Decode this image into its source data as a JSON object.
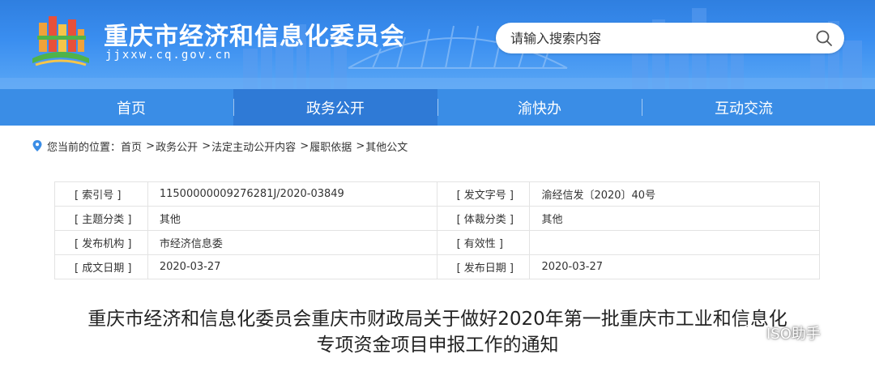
{
  "header": {
    "site_title": "重庆市经济和信息化委员会",
    "site_domain": "jjxxw.cq.gov.cn",
    "search_placeholder": "请输入搜索内容",
    "logo_icon": "city-logo-icon",
    "search_icon": "search-icon"
  },
  "nav": {
    "items": [
      {
        "label": "首页"
      },
      {
        "label": "政务公开"
      },
      {
        "label": "渝快办"
      },
      {
        "label": "互动交流"
      }
    ],
    "active": "政务公开"
  },
  "breadcrumb": {
    "prefix": "您当前的位置：",
    "items": [
      "首页",
      "政务公开",
      "法定主动公开内容",
      "履职依据",
      "其他公文"
    ],
    "separator": ">"
  },
  "info": {
    "rows": [
      {
        "l1": "[ 索引号 ]",
        "v1": "11500000009276281J/2020-03849",
        "l2": "[ 发文字号 ]",
        "v2": "渝经信发〔2020〕40号"
      },
      {
        "l1": "[ 主题分类 ]",
        "v1": "其他",
        "l2": "[ 体裁分类 ]",
        "v2": "其他"
      },
      {
        "l1": "[ 发布机构 ]",
        "v1": "市经济信息委",
        "l2": "[ 有效性 ]",
        "v2": ""
      },
      {
        "l1": "[ 成文日期 ]",
        "v1": "2020-03-27",
        "l2": "[ 发布日期 ]",
        "v2": "2020-03-27"
      }
    ]
  },
  "document": {
    "title_line1": "重庆市经济和信息化委员会重庆市财政局关于做好2020年第一批重庆市工业和信息化",
    "title_line2": "专项资金项目申报工作的通知"
  },
  "watermark": {
    "text": "ISO助手"
  },
  "colors": {
    "banner": "#3a8ef0",
    "nav": "#3a8de6",
    "nav_active": "#2f7ad6"
  }
}
